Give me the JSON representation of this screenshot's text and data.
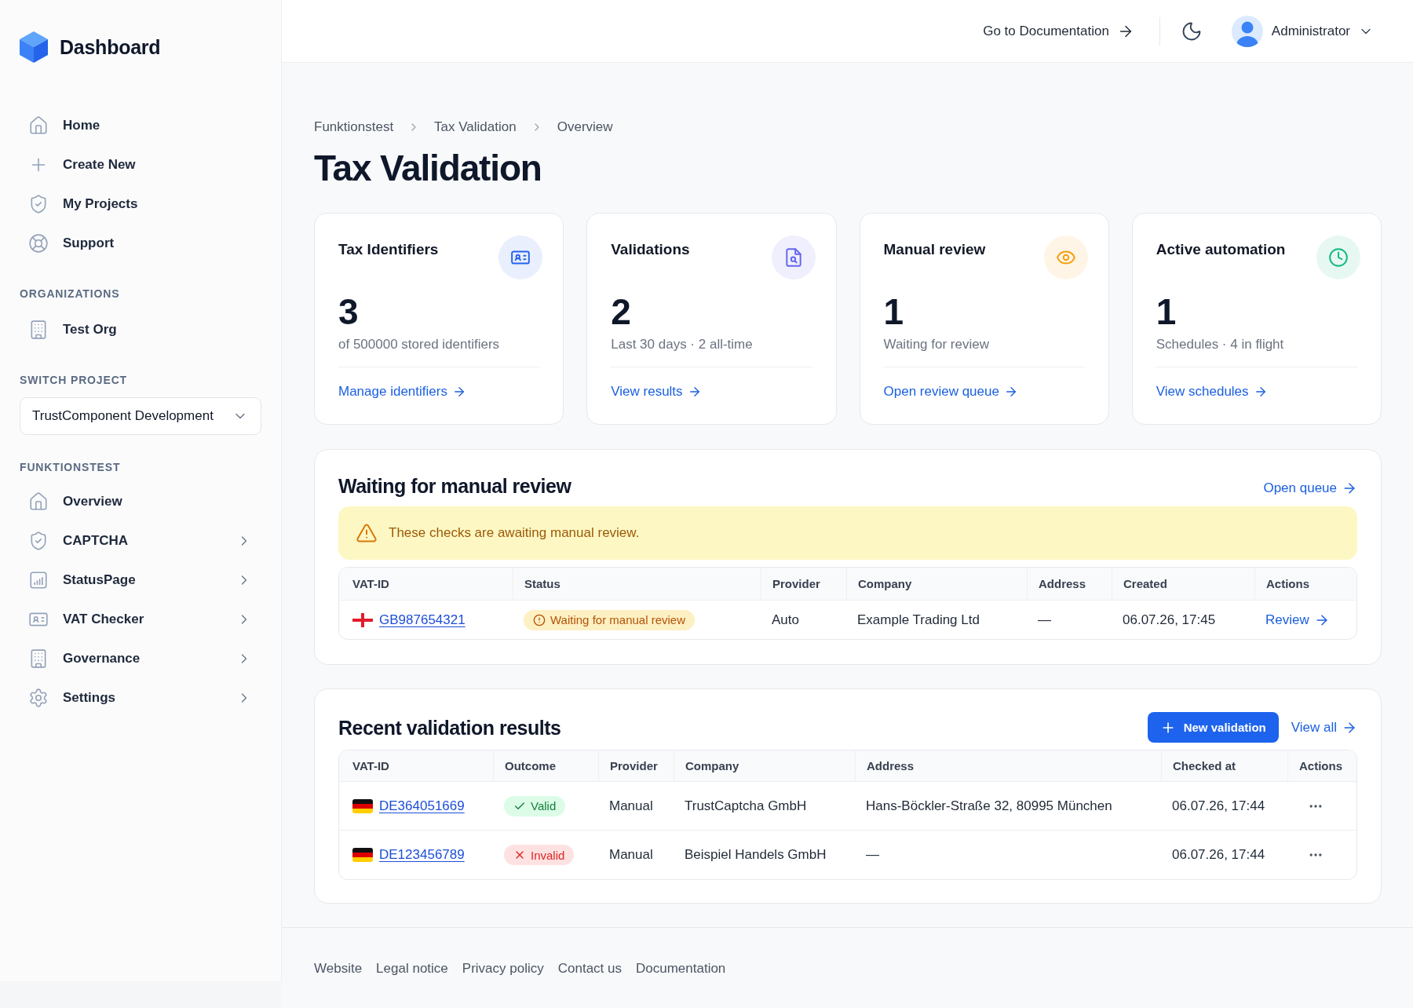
{
  "sidebar": {
    "brand": "Dashboard",
    "main_nav": [
      {
        "label": "Home"
      },
      {
        "label": "Create New"
      },
      {
        "label": "My Projects"
      },
      {
        "label": "Support"
      }
    ],
    "organizations": {
      "heading": "ORGANIZATIONS",
      "items": [
        {
          "label": "Test Org"
        }
      ]
    },
    "switch_project": {
      "heading": "SWITCH PROJECT",
      "value": "TrustComponent Development"
    },
    "project_nav": {
      "heading": "FUNKTIONSTEST",
      "items": [
        {
          "label": "Overview",
          "submenu": false
        },
        {
          "label": "CAPTCHA",
          "submenu": true
        },
        {
          "label": "StatusPage",
          "submenu": true
        },
        {
          "label": "VAT Checker",
          "submenu": true
        },
        {
          "label": "Governance",
          "submenu": true
        },
        {
          "label": "Settings",
          "submenu": true
        }
      ]
    }
  },
  "header": {
    "docs_link": "Go to Documentation",
    "user": "Administrator"
  },
  "breadcrumbs": [
    "Funktionstest",
    "Tax Validation",
    "Overview"
  ],
  "title": "Tax Validation",
  "cards": [
    {
      "title": "Tax Identifiers",
      "value": "3",
      "caption": "of 500000 stored identifiers",
      "link": "Manage identifiers",
      "color": "#2563eb"
    },
    {
      "title": "Validations",
      "value": "2",
      "caption": "Last 30 days · 2 all-time",
      "link": "View results",
      "color": "#6366f1"
    },
    {
      "title": "Manual review",
      "value": "1",
      "caption": "Waiting for review",
      "link": "Open review queue",
      "color": "#f59e0b"
    },
    {
      "title": "Active automation",
      "value": "1",
      "caption": "Schedules · 4 in flight",
      "link": "View schedules",
      "color": "#10b981"
    }
  ],
  "waiting": {
    "title": "Waiting for manual review",
    "link": "Open queue",
    "notice": "These checks are awaiting manual review.",
    "columns": [
      "VAT-ID",
      "Status",
      "Provider",
      "Company",
      "Address",
      "Created",
      "Actions"
    ],
    "rows": [
      {
        "kind": "gb",
        "vat_id": "GB987654321",
        "status": {
          "label": "Waiting for manual review",
          "kind": "waiting"
        },
        "provider": "Auto",
        "company": "Example Trading Ltd",
        "address": "—",
        "created": "06.07.26, 17:45",
        "action": "Review"
      }
    ]
  },
  "recent": {
    "title": "Recent validation results",
    "button": "New validation",
    "link": "View all",
    "columns": [
      "VAT-ID",
      "Outcome",
      "Provider",
      "Company",
      "Address",
      "Checked at",
      "Actions"
    ],
    "rows": [
      {
        "kind": "de",
        "vat_id": "DE364051669",
        "outcome": {
          "label": "Valid",
          "kind": "valid"
        },
        "provider": "Manual",
        "company": "TrustCaptcha GmbH",
        "address": "Hans-Böckler-Straße 32, 80995 München",
        "checked_at": "06.07.26, 17:44"
      },
      {
        "kind": "de",
        "vat_id": "DE123456789",
        "outcome": {
          "label": "Invalid",
          "kind": "invalid"
        },
        "provider": "Manual",
        "company": "Beispiel Handels GmbH",
        "address": "—",
        "checked_at": "06.07.26, 17:44"
      }
    ]
  },
  "footer": {
    "links": [
      "Website",
      "Legal notice",
      "Privacy policy",
      "Contact us",
      "Documentation"
    ]
  }
}
